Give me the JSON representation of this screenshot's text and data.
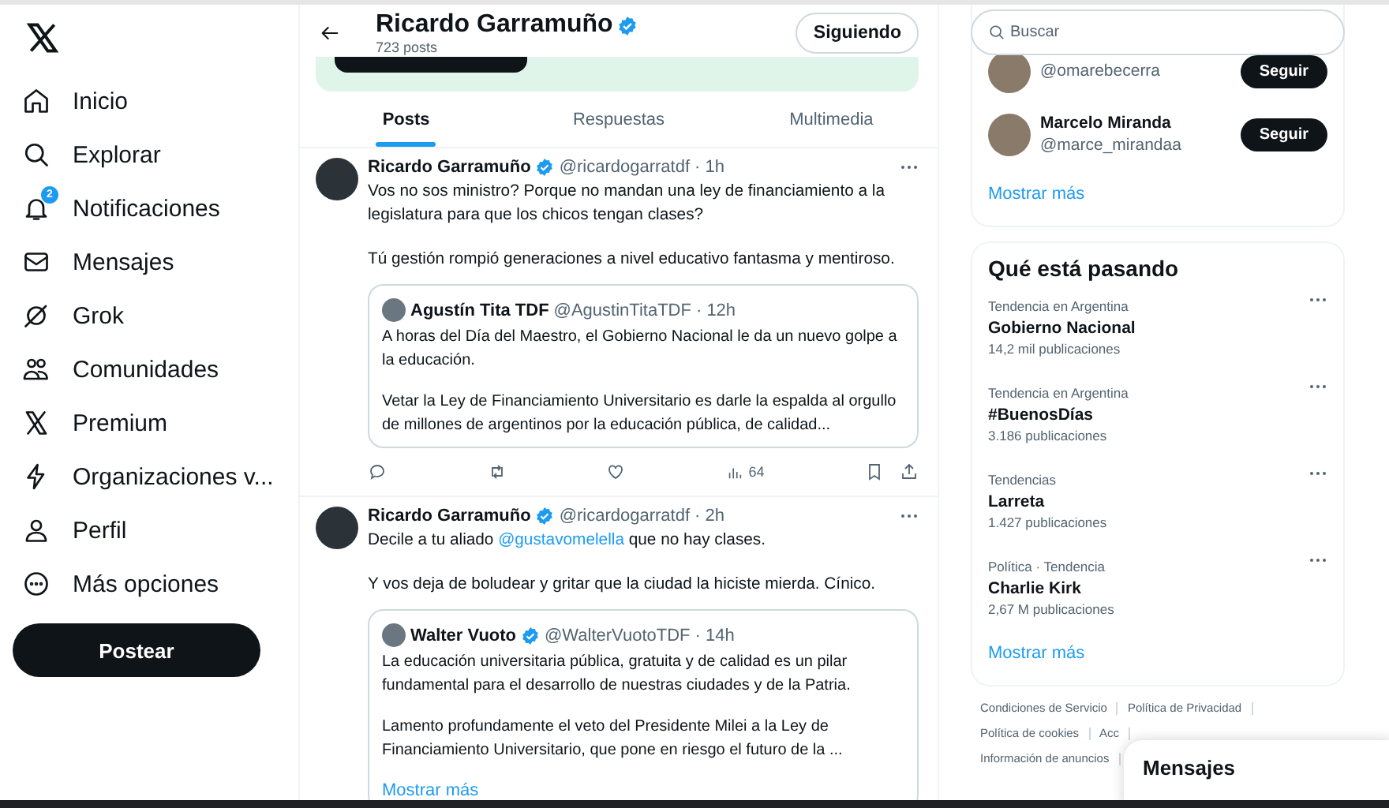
{
  "sidebar": {
    "items": [
      {
        "label": "Inicio"
      },
      {
        "label": "Explorar"
      },
      {
        "label": "Notificaciones",
        "badge": "2"
      },
      {
        "label": "Mensajes"
      },
      {
        "label": "Grok"
      },
      {
        "label": "Comunidades"
      },
      {
        "label": "Premium"
      },
      {
        "label": "Organizaciones v..."
      },
      {
        "label": "Perfil"
      },
      {
        "label": "Más opciones"
      }
    ],
    "post_button": "Postear"
  },
  "header": {
    "name": "Ricardo Garramuño",
    "verified": true,
    "posts_count": "723 posts",
    "follow_button": "Siguiendo"
  },
  "tabs": [
    {
      "label": "Posts",
      "selected": true
    },
    {
      "label": "Respuestas",
      "selected": false
    },
    {
      "label": "Multimedia",
      "selected": false
    }
  ],
  "posts": [
    {
      "name": "Ricardo Garramuño",
      "verified": true,
      "handle": "@ricardogarratdf",
      "time": "· 1h",
      "paragraphs": [
        [
          {
            "kind": "text",
            "text": "Vos no sos ministro? Porque no mandan una ley de financiamiento a la legislatura para que los chicos tengan clases?"
          }
        ],
        [
          {
            "kind": "text",
            "text": "Tú gestión rompió generaciones a nivel educativo fantasma y mentiroso."
          }
        ]
      ],
      "quote": {
        "name": "Agustín Tita TDF",
        "verified": false,
        "handle": "@AgustinTitaTDF",
        "time": "· 12h",
        "paragraphs": [
          "A horas del Día del Maestro, el Gobierno Nacional le da un nuevo golpe a la educación.",
          "Vetar la Ley de Financiamiento Universitario es darle la espalda al orgullo de millones de argentinos por la educación pública, de calidad..."
        ]
      },
      "views": "64"
    },
    {
      "name": "Ricardo Garramuño",
      "verified": true,
      "handle": "@ricardogarratdf",
      "time": "· 2h",
      "paragraphs": [
        [
          {
            "kind": "text",
            "text": "Decile a tu aliado "
          },
          {
            "kind": "mention",
            "text": "@gustavomelella"
          },
          {
            "kind": "text",
            "text": " que no hay clases."
          }
        ],
        [
          {
            "kind": "text",
            "text": "Y vos deja de boludear y gritar que la ciudad la hiciste mierda. Cínico."
          }
        ]
      ],
      "quote": {
        "name": "Walter Vuoto",
        "verified": true,
        "handle": "@WalterVuotoTDF",
        "time": "· 14h",
        "paragraphs": [
          "La educación universitaria pública, gratuita y de calidad es un pilar fundamental para el desarrollo de nuestras ciudades y de la Patria.",
          "Lamento profundamente el veto del Presidente Milei a la Ley de Financiamiento Universitario, que pone en riesgo el futuro de la ..."
        ],
        "show_more": "Mostrar más"
      }
    }
  ],
  "search": {
    "placeholder": "Buscar"
  },
  "who_to_follow": {
    "users": [
      {
        "handle": "@omarebecerra",
        "button": "Seguir"
      },
      {
        "name": "Marcelo Miranda",
        "handle": "@marce_mirandaa",
        "button": "Seguir"
      }
    ],
    "show_more": "Mostrar más"
  },
  "trends": {
    "title": "Qué está pasando",
    "items": [
      {
        "context": "Tendencia en Argentina",
        "topic": "Gobierno Nacional",
        "count": "14,2 mil publicaciones"
      },
      {
        "context": "Tendencia en Argentina",
        "topic": "#BuenosDías",
        "count": "3.186 publicaciones"
      },
      {
        "context": "Tendencias",
        "topic": "Larreta",
        "count": "1.427 publicaciones"
      },
      {
        "context": "Política · Tendencia",
        "topic": "Charlie Kirk",
        "count": "2,67 M publicaciones"
      }
    ],
    "show_more": "Mostrar más"
  },
  "footer_links": [
    "Condiciones de Servicio",
    "Política de Privacidad",
    "Política de cookies",
    "Acc",
    "Información de anuncios"
  ],
  "messages_drawer": {
    "title": "Mensajes"
  }
}
